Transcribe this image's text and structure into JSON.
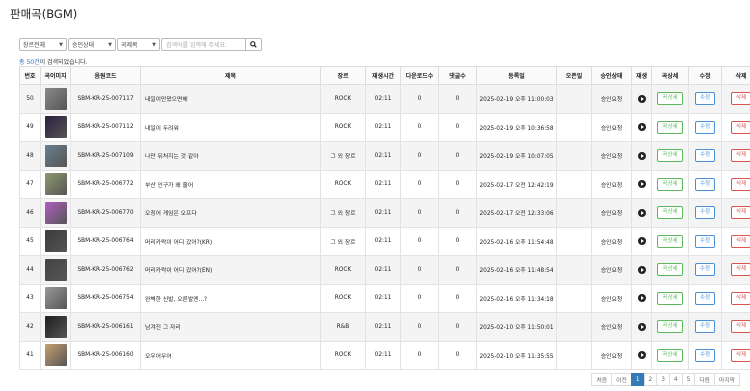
{
  "page": {
    "title": "판매곡(BGM)"
  },
  "filters": {
    "genre": "장르전체",
    "status": "승인상태",
    "category": "곡제목",
    "search_placeholder": "검색어를 입력해 주세요."
  },
  "result": {
    "prefix": "총 ",
    "count": "50건",
    "suffix": "이 검색되었습니다."
  },
  "table": {
    "headers": [
      "번호",
      "곡이미지",
      "음원코드",
      "제목",
      "장르",
      "재생시간",
      "다운로드수",
      "댓글수",
      "등록일",
      "오픈일",
      "승인상태",
      "재생",
      "곡상세",
      "수정",
      "삭제"
    ],
    "rows": [
      {
        "no": "50",
        "code": "SBM-KR-25-007117",
        "title": "내일이만왔으면해",
        "genre": "ROCK",
        "time": "02:11",
        "downloads": "0",
        "comments": "0",
        "date": "2025-02-19 오후 11:00:03",
        "open": "",
        "status": "승인요청",
        "cover": "#8a8a8a"
      },
      {
        "no": "49",
        "code": "SBM-KR-25-007112",
        "title": "내일이 두려워",
        "genre": "ROCK",
        "time": "02:11",
        "downloads": "0",
        "comments": "0",
        "date": "2025-02-19 오후 10:36:58",
        "open": "",
        "status": "승인요청",
        "cover": "#2a2040"
      },
      {
        "no": "48",
        "code": "SBM-KR-25-007109",
        "title": "나만 뒤처지는 것 같아",
        "genre": "그 외 장르",
        "time": "02:11",
        "downloads": "0",
        "comments": "0",
        "date": "2025-02-19 오후 10:07:05",
        "open": "",
        "status": "승인요청",
        "cover": "#6a7f8f"
      },
      {
        "no": "47",
        "code": "SBM-KR-25-006772",
        "title": "부산 인구가 왜 줄어",
        "genre": "ROCK",
        "time": "02:11",
        "downloads": "0",
        "comments": "0",
        "date": "2025-02-17 오전 12:42:19",
        "open": "",
        "status": "승인요청",
        "cover": "#8f9a70"
      },
      {
        "no": "46",
        "code": "SBM-KR-25-006770",
        "title": "오징어 게임은 오프다",
        "genre": "그 외 장르",
        "time": "02:11",
        "downloads": "0",
        "comments": "0",
        "date": "2025-02-17 오전 12:33:06",
        "open": "",
        "status": "승인요청",
        "cover": "#b060c0"
      },
      {
        "no": "45",
        "code": "SBM-KR-25-006764",
        "title": "머리카락이 어디 갔어?(KR)",
        "genre": "그 외 장르",
        "time": "02:11",
        "downloads": "0",
        "comments": "0",
        "date": "2025-02-16 오후 11:54:48",
        "open": "",
        "status": "승인요청",
        "cover": "#3a3a3a"
      },
      {
        "no": "44",
        "code": "SBM-KR-25-006762",
        "title": "머리카락이 어디 갔어?(EN)",
        "genre": "ROCK",
        "time": "02:11",
        "downloads": "0",
        "comments": "0",
        "date": "2025-02-16 오후 11:48:54",
        "open": "",
        "status": "승인요청",
        "cover": "#444444"
      },
      {
        "no": "43",
        "code": "SBM-KR-25-006754",
        "title": "완벽한 신발, 오른발엔...?",
        "genre": "ROCK",
        "time": "02:11",
        "downloads": "0",
        "comments": "0",
        "date": "2025-02-16 오후 11:34:18",
        "open": "",
        "status": "승인요청",
        "cover": "#9a9a9a"
      },
      {
        "no": "42",
        "code": "SBM-KR-25-006161",
        "title": "남겨진 그 자리",
        "genre": "R&B",
        "time": "02:11",
        "downloads": "0",
        "comments": "0",
        "date": "2025-02-10 오후 11:50:01",
        "open": "",
        "status": "승인요청",
        "cover": "#1e1e1e"
      },
      {
        "no": "41",
        "code": "SBM-KR-25-006160",
        "title": "오우어우어",
        "genre": "ROCK",
        "time": "02:11",
        "downloads": "0",
        "comments": "0",
        "date": "2025-02-10 오후 11:35:55",
        "open": "",
        "status": "승인요청",
        "cover": "#c8a070"
      }
    ],
    "actions": {
      "detail": "곡상세",
      "edit": "수정",
      "delete": "삭제"
    }
  },
  "pagination": {
    "first": "처음",
    "prev": "이전",
    "pages": [
      "1",
      "2",
      "3",
      "4",
      "5"
    ],
    "current": "1",
    "next": "다음",
    "last": "마지막"
  }
}
